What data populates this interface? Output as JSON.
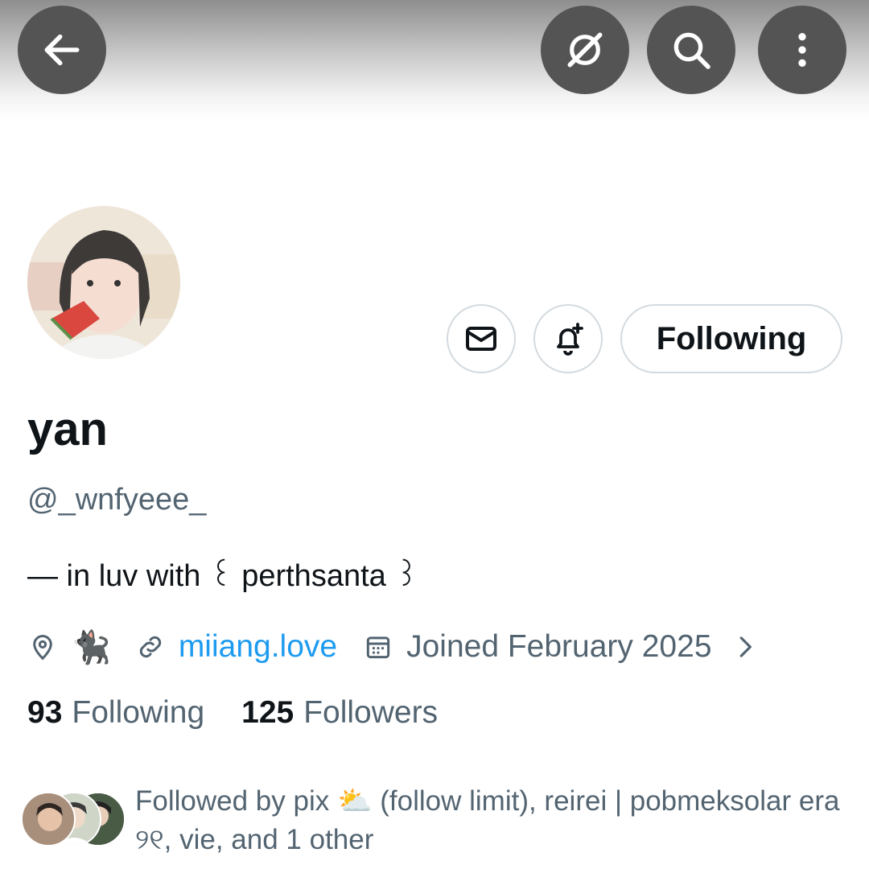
{
  "header": {
    "back_icon": "arrow-left-icon",
    "grok_icon": "grok-icon",
    "search_icon": "search-icon",
    "more_icon": "more-vertical-icon"
  },
  "profile": {
    "name": "yan",
    "handle": "@_wnfyeee_",
    "bio": "— in luv with ꒰ perthsanta ꒱",
    "location_emoji": "🐈‍⬛",
    "link": "miiang.love",
    "joined": "Joined February 2025",
    "following_count": "93",
    "following_label": "Following",
    "followers_count": "125",
    "followers_label": "Followers",
    "followed_by": "Followed by pix ⛅ (follow limit), reirei | pobmeksolar era ୨୧, vie, and 1 other"
  },
  "actions": {
    "message_icon": "mail-icon",
    "notify_icon": "bell-plus-icon",
    "following_button": "Following"
  },
  "colors": {
    "link": "#1d9bf0",
    "secondary_text": "#536471",
    "primary_text": "#0f1419",
    "header_button": "#545454"
  }
}
